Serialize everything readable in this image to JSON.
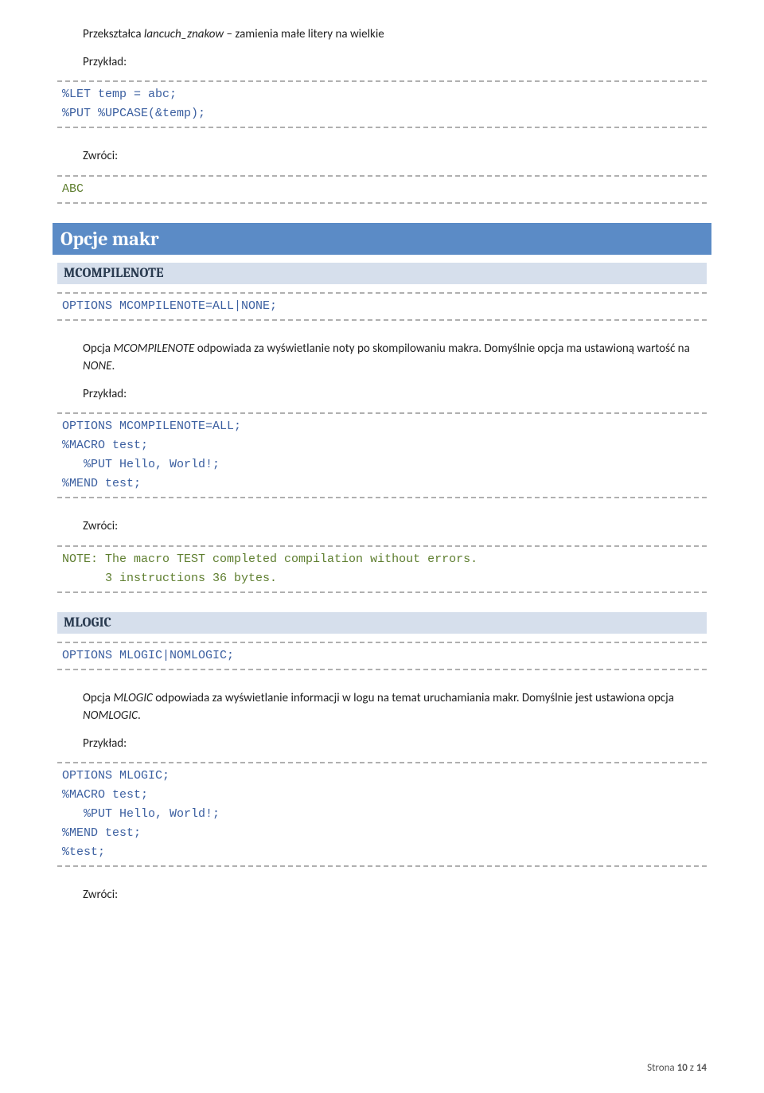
{
  "intro": {
    "desc_prefix": "Przekształca ",
    "desc_italic": "lancuch_znakow",
    "desc_suffix": " – zamienia małe litery na wielkie",
    "example_label": "Przykład:",
    "code": "%LET temp = abc;\n%PUT %UPCASE(&temp);",
    "returns_label": "Zwróci:",
    "output": "ABC"
  },
  "h1": "Opcje makr",
  "mcompilenote": {
    "title": "MCOMPILENOTE",
    "syntax": "OPTIONS MCOMPILENOTE=ALL|NONE;",
    "desc_prefix": "Opcja ",
    "desc_italic1": "MCOMPILENOTE",
    "desc_mid": " odpowiada za wyświetlanie noty po skompilowaniu makra. Domyślnie opcja ma ustawioną wartość na ",
    "desc_italic2": "NONE",
    "desc_suffix": ".",
    "example_label": "Przykład:",
    "code": "OPTIONS MCOMPILENOTE=ALL;\n%MACRO test;\n   %PUT Hello, World!;\n%MEND test;",
    "returns_label": "Zwróci:",
    "output": "NOTE: The macro TEST completed compilation without errors.\n      3 instructions 36 bytes."
  },
  "mlogic": {
    "title": "MLOGIC",
    "syntax": "OPTIONS MLOGIC|NOMLOGIC;",
    "desc_prefix": "Opcja ",
    "desc_italic1": "MLOGIC",
    "desc_mid": " odpowiada za wyświetlanie informacji w logu na temat uruchamiania makr. Domyślnie jest ustawiona opcja ",
    "desc_italic2": "NOMLOGIC",
    "desc_suffix": ".",
    "example_label": "Przykład:",
    "code": "OPTIONS MLOGIC;\n%MACRO test;\n   %PUT Hello, World!;\n%MEND test;\n%test;",
    "returns_label": "Zwróci:"
  },
  "footer": {
    "prefix": "Strona ",
    "page": "10",
    "mid": " z ",
    "total": "14"
  }
}
